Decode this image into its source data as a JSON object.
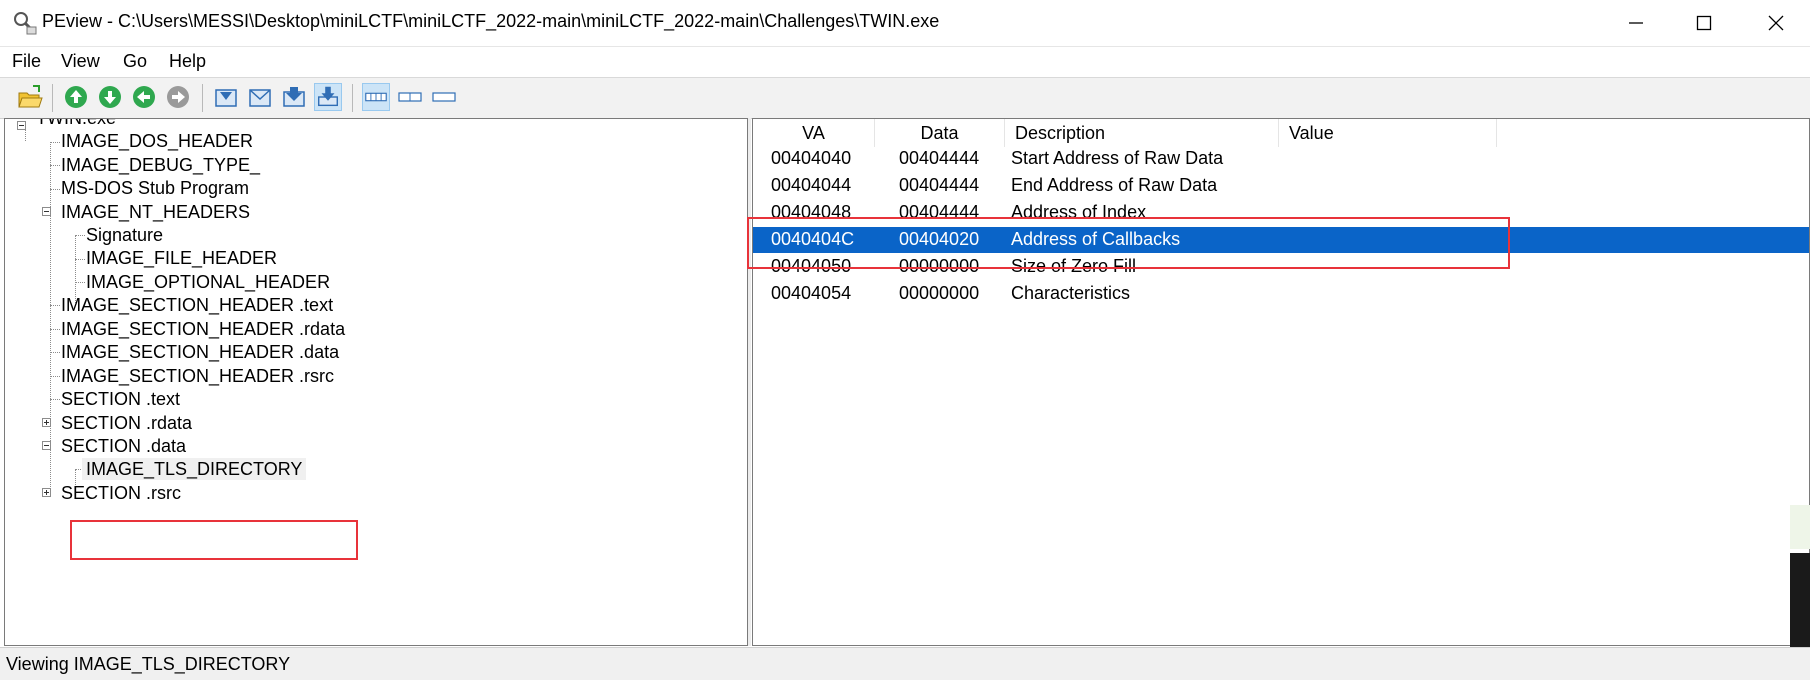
{
  "window": {
    "title": "PEview - C:\\Users\\MESSI\\Desktop\\miniLCTF\\miniLCTF_2022-main\\miniLCTF_2022-main\\Challenges\\TWIN.exe",
    "icon": "magnifier-pe-icon",
    "controls": [
      "minimize-icon",
      "maximize-icon",
      "close-icon"
    ]
  },
  "menu": [
    "File",
    "View",
    "Go",
    "Help"
  ],
  "toolbar": {
    "buttons": [
      "open-file-icon",
      "go-up-icon",
      "go-down-icon",
      "go-back-icon",
      "go-forward-icon",
      "view-first-icon",
      "view-mail-icon",
      "view-next-icon",
      "view-download-icon",
      "view-bytes-icon",
      "view-words-icon",
      "view-dwords-icon"
    ]
  },
  "tree": {
    "root": "TWIN.exe",
    "nodes": [
      "IMAGE_DOS_HEADER",
      "IMAGE_DEBUG_TYPE_",
      "MS-DOS Stub Program",
      "IMAGE_NT_HEADERS",
      "Signature",
      "IMAGE_FILE_HEADER",
      "IMAGE_OPTIONAL_HEADER",
      "IMAGE_SECTION_HEADER .text",
      "IMAGE_SECTION_HEADER .rdata",
      "IMAGE_SECTION_HEADER .data",
      "IMAGE_SECTION_HEADER .rsrc",
      "SECTION .text",
      "SECTION .rdata",
      "SECTION .data",
      "IMAGE_TLS_DIRECTORY",
      "SECTION .rsrc"
    ],
    "selected": "IMAGE_TLS_DIRECTORY"
  },
  "list": {
    "columns": [
      "VA",
      "Data",
      "Description",
      "Value"
    ],
    "rows": [
      {
        "va": "00404040",
        "data": "00404444",
        "desc": "Start Address of Raw Data",
        "value": ""
      },
      {
        "va": "00404044",
        "data": "00404444",
        "desc": "End Address of Raw Data",
        "value": ""
      },
      {
        "va": "00404048",
        "data": "00404444",
        "desc": "Address of Index",
        "value": ""
      },
      {
        "va": "0040404C",
        "data": "00404020",
        "desc": "Address of Callbacks",
        "value": ""
      },
      {
        "va": "00404050",
        "data": "00000000",
        "desc": "Size of Zero Fill",
        "value": ""
      },
      {
        "va": "00404054",
        "data": "00000000",
        "desc": "Characteristics",
        "value": ""
      }
    ],
    "selected_row": 3
  },
  "status": "Viewing IMAGE_TLS_DIRECTORY",
  "colors": {
    "selection": "#0a64c8",
    "annotation": "#e8333a"
  }
}
